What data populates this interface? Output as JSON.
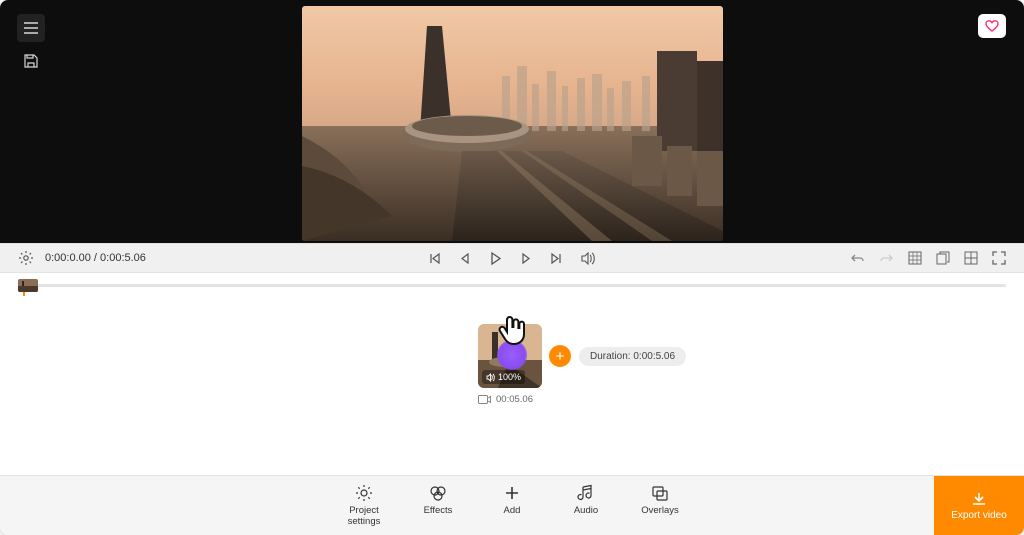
{
  "preview": {
    "current_time": "0:00:0.00",
    "total_time": "0:00:5.06",
    "time_display": "0:00:0.00 / 0:00:5.06"
  },
  "clip": {
    "volume_label": "100%",
    "duration_meta": "00:05.06",
    "duration_pill": "Duration: 0:00:5.06"
  },
  "tools": {
    "project": "Project\nsettings",
    "effects": "Effects",
    "add": "Add",
    "audio": "Audio",
    "overlays": "Overlays"
  },
  "export": {
    "label": "Export video"
  },
  "colors": {
    "accent": "#ff8a00"
  }
}
